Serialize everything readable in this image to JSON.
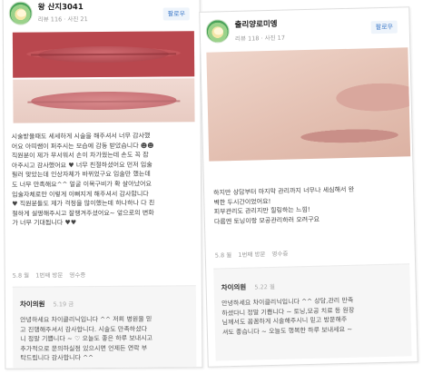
{
  "left_post": {
    "author": "왕 산지3041",
    "meta": "리뷰 116 · 사진 21",
    "follow": "팔로우",
    "body_lines": [
      "시술받을때도 세세하게 시술을 해주셔서 너무 감사했",
      "어요 아띠쌤이 퍼주시는 모습에 감동 받았습니다 ☻☻",
      "직원분이 제가 무서워서 손이 차가웠는데 손도 꼭 잡",
      "아주시고 감사했어요 ♥ 너무 친절하셨어요 먼저 입술",
      "필러 맞았는데 인상자체가 바뀌었구요 입술만 했는데",
      "도 너무 만족해요^^ 얼굴 이목구비가 확 살아났어요",
      "입술자체로만 이렇게 이뻐지게 해주셔서 감사합니다",
      "♥ 직원분들도 제가 걱정을 많이했는데 하나하나 다 친",
      "절하게 설명해주시고 잘챙겨주셨어요~ 앞으로의 변화",
      "가 너무 기대됩니다 ♥♥"
    ],
    "date": "5.8 월",
    "visits": "1번째 방문",
    "receipt": "영수증",
    "reply": {
      "author": "차이의원",
      "date": "5.19 금",
      "lines": [
        "안녕하세요 차이클리닉입니다 ^^ 저희 병원을 믿",
        "고 진행해주셔서 감사합니다. 시술도 만족하셨다",
        "니 정말 기쁩니다 ~ ♡ 오늘도 좋은 하루 보내시고",
        "추가적으로 문의하실점 있으시면 언제든 연락 부",
        "탁드립니다 감사합니다 ^^"
      ]
    }
  },
  "right_post": {
    "author": "출리양로미엥",
    "meta": "리뷰 118 · 사진 17",
    "follow": "팔로우",
    "body_lines": [
      "하지만 상담부터 마지막 관리까지 너무나 세심해서 완",
      "벽한 두시간이었어요!",
      "피부관리도 관리지만 힐링하는 느낌!",
      "다름엔 토닝이랑 모공관리하러 오려구요"
    ],
    "date": "5.8 월",
    "visits": "1번째 방문",
    "receipt": "영수증",
    "reply": {
      "author": "차이의원",
      "date": "5.22 월",
      "lines": [
        "안녕하세요 차이클리닉입니다 ^^ 상담,관리 만족",
        "하셨다니 정말 기쁩니다 ~ 토닝,모공 치료 등 원장",
        "님께서도 꼼꼼하게 시술해주시니 믿고 방문해주",
        "셔도 좋습니다 ~ 오늘도 행복한 하루 보내세요 ~"
      ]
    }
  }
}
